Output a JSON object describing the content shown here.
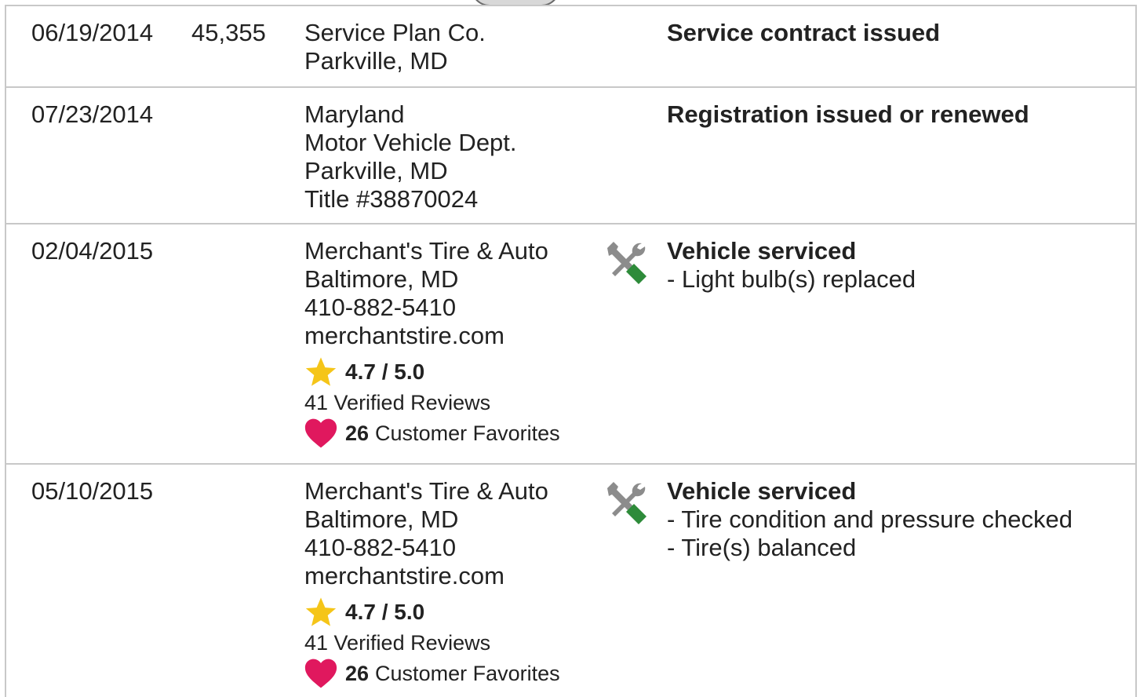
{
  "records": [
    {
      "date": "06/19/2014",
      "mileage": "45,355",
      "source": [
        "Service Plan Co.",
        "Parkville, MD"
      ],
      "headline": "Service contract issued",
      "details": []
    },
    {
      "date": "07/23/2014",
      "mileage": "",
      "source": [
        "Maryland",
        "Motor Vehicle Dept.",
        "Parkville, MD",
        "Title #38870024"
      ],
      "headline": "Registration issued or renewed",
      "details": []
    },
    {
      "date": "02/04/2015",
      "mileage": "",
      "source": [
        "Merchant's Tire & Auto",
        "Baltimore, MD",
        "410-882-5410",
        "merchantstire.com"
      ],
      "rating": "4.7 / 5.0",
      "reviews": "41 Verified Reviews",
      "favorites_count": "26",
      "favorites_label": "Customer Favorites",
      "icon": "service-tools-icon",
      "headline": "Vehicle serviced",
      "details": [
        "- Light bulb(s) replaced"
      ]
    },
    {
      "date": "05/10/2015",
      "mileage": "",
      "source": [
        "Merchant's Tire & Auto",
        "Baltimore, MD",
        "410-882-5410",
        "merchantstire.com"
      ],
      "rating": "4.7 / 5.0",
      "reviews": "41 Verified Reviews",
      "favorites_count": "26",
      "favorites_label": "Customer Favorites",
      "icon": "service-tools-icon",
      "headline": "Vehicle serviced",
      "details": [
        "- Tire condition and pressure checked",
        "- Tire(s) balanced"
      ]
    }
  ],
  "colors": {
    "star": "#F5C518",
    "heart": "#E0185E",
    "wrench": "#8C8C8C",
    "screwdriver": "#2E8B3A",
    "divider": "#C8C8C8",
    "text": "#222222"
  }
}
